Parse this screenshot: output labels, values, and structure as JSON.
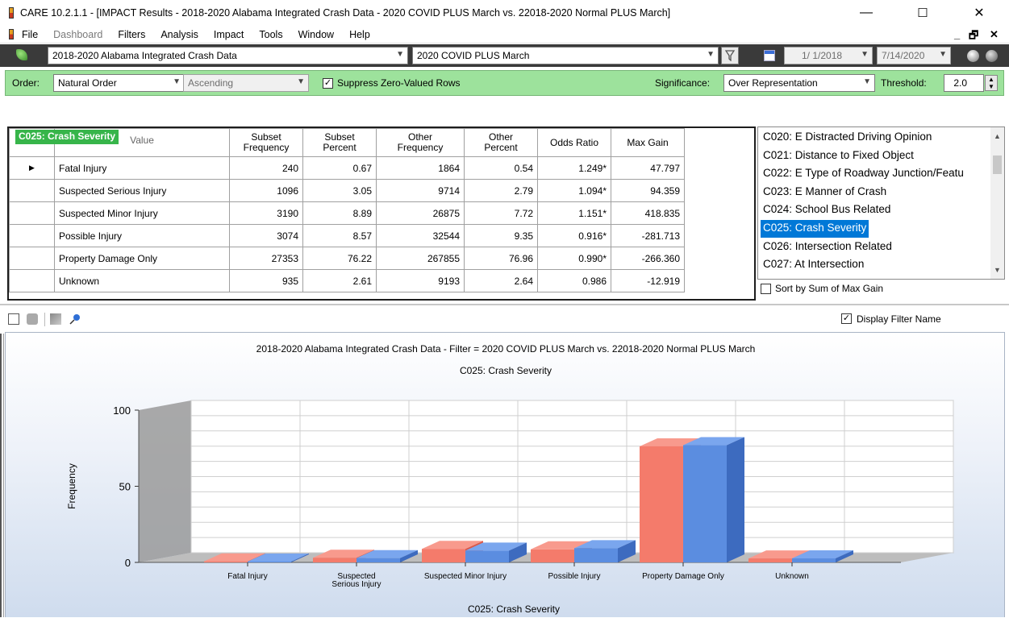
{
  "window": {
    "title": "CARE 10.2.1.1 - [IMPACT Results - 2018-2020 Alabama Integrated Crash Data - 2020 COVID PLUS March vs. 22018-2020 Normal PLUS March]",
    "minimize_icon": "—",
    "maximize_icon": "☐",
    "close_icon": "✕"
  },
  "menu": {
    "items": [
      "File",
      "Dashboard",
      "Filters",
      "Analysis",
      "Impact",
      "Tools",
      "Window",
      "Help"
    ],
    "mdi_min": "_",
    "mdi_restore": "🗗",
    "mdi_close": "✕"
  },
  "toolbar": {
    "dataset": "2018-2020 Alabama Integrated Crash Data",
    "filter": "2020 COVID PLUS March",
    "date_from": "1/ 1/2018",
    "date_to": "7/14/2020"
  },
  "options": {
    "order_label": "Order:",
    "order_value": "Natural Order",
    "direction_value": "Ascending",
    "suppress_label": "Suppress Zero-Valued Rows",
    "suppress_checked": "✓",
    "significance_label": "Significance:",
    "significance_value": "Over Representation",
    "threshold_label": "Threshold:",
    "threshold_value": "2.0"
  },
  "grid": {
    "group_label": "C025: Crash Severity",
    "value_header": "Value",
    "columns": [
      [
        "Subset",
        "Frequency"
      ],
      [
        "Subset",
        "Percent"
      ],
      [
        "Other",
        "Frequency"
      ],
      [
        "Other",
        "Percent"
      ],
      [
        "Odds Ratio"
      ],
      [
        "Max Gain"
      ]
    ],
    "current_row_marker": "▶",
    "rows": [
      {
        "value": "Fatal Injury",
        "sf": "240",
        "sp": "0.67",
        "of": "1864",
        "op": "0.54",
        "odds": "1.249*",
        "gain": "47.797"
      },
      {
        "value": "Suspected Serious Injury",
        "sf": "1096",
        "sp": "3.05",
        "of": "9714",
        "op": "2.79",
        "odds": "1.094*",
        "gain": "94.359"
      },
      {
        "value": "Suspected Minor Injury",
        "sf": "3190",
        "sp": "8.89",
        "of": "26875",
        "op": "7.72",
        "odds": "1.151*",
        "gain": "418.835"
      },
      {
        "value": "Possible Injury",
        "sf": "3074",
        "sp": "8.57",
        "of": "32544",
        "op": "9.35",
        "odds": "0.916*",
        "gain": "-281.713"
      },
      {
        "value": "Property Damage Only",
        "sf": "27353",
        "sp": "76.22",
        "of": "267855",
        "op": "76.96",
        "odds": "0.990*",
        "gain": "-266.360"
      },
      {
        "value": "Unknown",
        "sf": "935",
        "sp": "2.61",
        "of": "9193",
        "op": "2.64",
        "odds": "0.986",
        "gain": "-12.919"
      }
    ]
  },
  "column_list": {
    "items": [
      "C020: E Distracted Driving Opinion",
      "C021: Distance to Fixed Object",
      "C022: E Type of Roadway Junction/Featu",
      "C023: E Manner of Crash",
      "C024: School Bus Related",
      "C025: Crash Severity",
      "C026: Intersection Related",
      "C027: At Intersection"
    ],
    "selected_index": 5,
    "sort_label": "Sort by Sum of Max Gain"
  },
  "chart_panel": {
    "display_filter_label": "Display Filter Name",
    "display_filter_checked": "✓"
  },
  "chart_data": {
    "type": "bar",
    "title": "2018-2020 Alabama Integrated Crash Data - Filter = 2020 COVID PLUS March vs. 22018-2020 Normal PLUS March",
    "subtitle": "C025: Crash Severity",
    "xlabel": "C025: Crash Severity",
    "ylabel": "Frequency",
    "categories": [
      "Fatal Injury",
      "Suspected Serious Injury",
      "Suspected Minor Injury",
      "Possible Injury",
      "Property Damage Only",
      "Unknown"
    ],
    "series": [
      {
        "values": [
          0.67,
          3.05,
          8.89,
          8.57,
          76.22,
          2.61
        ],
        "color": "#f47b6b"
      },
      {
        "values": [
          0.54,
          2.79,
          7.72,
          9.35,
          76.96,
          2.64
        ],
        "color": "#5b8de0"
      }
    ],
    "yticks": [
      "0",
      "50",
      "100"
    ],
    "ylim": [
      0,
      100
    ],
    "three_d": true,
    "grid": true
  }
}
